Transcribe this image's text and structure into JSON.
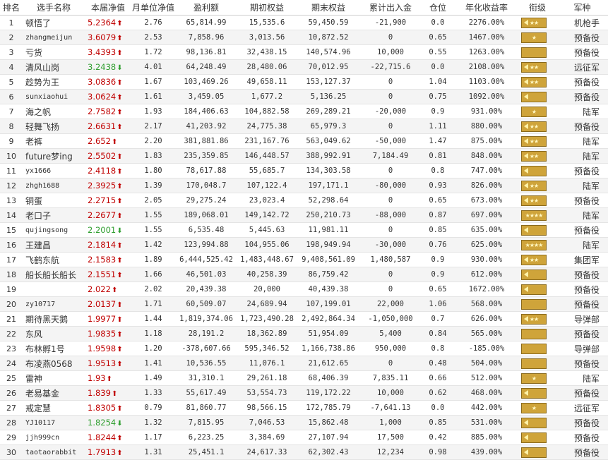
{
  "headers": [
    "排名",
    "选手名称",
    "本届净值",
    "月单位净值",
    "盈利额",
    "期初权益",
    "期末权益",
    "累计出入金",
    "仓位",
    "年化收益率",
    "衔级",
    "军种"
  ],
  "colors": {
    "up": "#c00000",
    "down": "#2f9e2f",
    "badge": "#cfa43a"
  },
  "rows": [
    {
      "rank": "1",
      "name": "顿悟了",
      "net": "5.2364",
      "dir": "up",
      "monthly": "2.76",
      "profit": "65,814.99",
      "start": "15,535.6",
      "end": "59,450.59",
      "flow": "-21,900",
      "pos": "0.0",
      "annual": "2276.00%",
      "badge": "chevron-stars",
      "army": "机枪手"
    },
    {
      "rank": "2",
      "name": "zhangmeijun",
      "net": "3.6079",
      "dir": "up",
      "monthly": "2.53",
      "profit": "7,858.96",
      "start": "3,013.56",
      "end": "10,872.52",
      "flow": "0",
      "pos": "0.65",
      "annual": "1467.00%",
      "badge": "star",
      "army": "预备役"
    },
    {
      "rank": "3",
      "name": "亏货",
      "net": "3.4393",
      "dir": "up",
      "monthly": "1.72",
      "profit": "98,136.81",
      "start": "32,438.15",
      "end": "140,574.96",
      "flow": "10,000",
      "pos": "0.55",
      "annual": "1263.00%",
      "badge": "bar",
      "army": "预备役"
    },
    {
      "rank": "4",
      "name": "清风山岗",
      "net": "3.2438",
      "dir": "down",
      "monthly": "4.01",
      "profit": "64,248.49",
      "start": "28,480.06",
      "end": "70,012.95",
      "flow": "-22,715.6",
      "pos": "0.0",
      "annual": "2108.00%",
      "badge": "chevron-stars",
      "army": "远征军"
    },
    {
      "rank": "5",
      "name": "趁势为王",
      "net": "3.0836",
      "dir": "up",
      "monthly": "1.67",
      "profit": "103,469.26",
      "start": "49,658.11",
      "end": "153,127.37",
      "flow": "0",
      "pos": "1.04",
      "annual": "1103.00%",
      "badge": "chevron-stars",
      "army": "预备役"
    },
    {
      "rank": "6",
      "name": "sunxiaohui",
      "net": "3.0624",
      "dir": "up",
      "monthly": "1.61",
      "profit": "3,459.05",
      "start": "1,677.2",
      "end": "5,136.25",
      "flow": "0",
      "pos": "0.75",
      "annual": "1092.00%",
      "badge": "chevron",
      "army": "预备役"
    },
    {
      "rank": "7",
      "name": "海之帆",
      "net": "2.7582",
      "dir": "up",
      "monthly": "1.93",
      "profit": "184,406.63",
      "start": "104,882.58",
      "end": "269,289.21",
      "flow": "-20,000",
      "pos": "0.9",
      "annual": "931.00%",
      "badge": "star",
      "army": "陆军"
    },
    {
      "rank": "8",
      "name": "轻舞飞扬",
      "net": "2.6631",
      "dir": "up",
      "monthly": "2.17",
      "profit": "41,203.92",
      "start": "24,775.38",
      "end": "65,979.3",
      "flow": "0",
      "pos": "1.11",
      "annual": "880.00%",
      "badge": "chevron-stars",
      "army": "预备役"
    },
    {
      "rank": "9",
      "name": "老裤",
      "net": "2.652",
      "dir": "up",
      "monthly": "2.20",
      "profit": "381,881.86",
      "start": "231,167.76",
      "end": "563,049.62",
      "flow": "-50,000",
      "pos": "1.47",
      "annual": "875.00%",
      "badge": "chevron-stars",
      "army": "陆军"
    },
    {
      "rank": "10",
      "name": "future梦ing",
      "net": "2.5502",
      "dir": "up",
      "monthly": "1.83",
      "profit": "235,359.85",
      "start": "146,448.57",
      "end": "388,992.91",
      "flow": "7,184.49",
      "pos": "0.81",
      "annual": "848.00%",
      "badge": "chevron-stars",
      "army": "陆军"
    },
    {
      "rank": "11",
      "name": "yx1666",
      "net": "2.4118",
      "dir": "up",
      "monthly": "1.80",
      "profit": "78,617.88",
      "start": "55,685.7",
      "end": "134,303.58",
      "flow": "0",
      "pos": "0.8",
      "annual": "747.00%",
      "badge": "chevron",
      "army": "预备役"
    },
    {
      "rank": "12",
      "name": "zhgh1688",
      "net": "2.3925",
      "dir": "up",
      "monthly": "1.39",
      "profit": "170,048.7",
      "start": "107,122.4",
      "end": "197,171.1",
      "flow": "-80,000",
      "pos": "0.93",
      "annual": "826.00%",
      "badge": "chevron-stars",
      "army": "陆军"
    },
    {
      "rank": "13",
      "name": "铜蛋",
      "net": "2.2715",
      "dir": "up",
      "monthly": "2.05",
      "profit": "29,275.24",
      "start": "23,023.4",
      "end": "52,298.64",
      "flow": "0",
      "pos": "0.65",
      "annual": "673.00%",
      "badge": "chevron-stars",
      "army": "预备役"
    },
    {
      "rank": "14",
      "name": "老口子",
      "net": "2.2677",
      "dir": "up",
      "monthly": "1.55",
      "profit": "189,068.01",
      "start": "149,142.72",
      "end": "250,210.73",
      "flow": "-88,000",
      "pos": "0.87",
      "annual": "697.00%",
      "badge": "stars4",
      "army": "陆军"
    },
    {
      "rank": "15",
      "name": "qujingsong",
      "net": "2.2001",
      "dir": "down",
      "monthly": "1.55",
      "profit": "6,535.48",
      "start": "5,445.63",
      "end": "11,981.11",
      "flow": "0",
      "pos": "0.85",
      "annual": "635.00%",
      "badge": "chevron",
      "army": "预备役"
    },
    {
      "rank": "16",
      "name": "王建昌",
      "net": "2.1814",
      "dir": "up",
      "monthly": "1.42",
      "profit": "123,994.88",
      "start": "104,955.06",
      "end": "198,949.94",
      "flow": "-30,000",
      "pos": "0.76",
      "annual": "625.00%",
      "badge": "stars4",
      "army": "陆军"
    },
    {
      "rank": "17",
      "name": "飞鹤东航",
      "net": "2.1583",
      "dir": "up",
      "monthly": "1.89",
      "profit": "6,444,525.42",
      "start": "1,483,448.67",
      "end": "9,408,561.09",
      "flow": "1,480,587",
      "pos": "0.9",
      "annual": "930.00%",
      "badge": "chevron-stars",
      "army": "集团军"
    },
    {
      "rank": "18",
      "name": "船长船长船长",
      "net": "2.1551",
      "dir": "up",
      "monthly": "1.66",
      "profit": "46,501.03",
      "start": "40,258.39",
      "end": "86,759.42",
      "flow": "0",
      "pos": "0.9",
      "annual": "612.00%",
      "badge": "chevron",
      "army": "预备役"
    },
    {
      "rank": "19",
      "name": "",
      "net": "2.022",
      "dir": "up",
      "monthly": "2.02",
      "profit": "20,439.38",
      "start": "20,000",
      "end": "40,439.38",
      "flow": "0",
      "pos": "0.65",
      "annual": "1672.00%",
      "badge": "chevron",
      "army": "预备役"
    },
    {
      "rank": "20",
      "name": "zy10717",
      "net": "2.0137",
      "dir": "up",
      "monthly": "1.71",
      "profit": "60,509.07",
      "start": "24,689.94",
      "end": "107,199.01",
      "flow": "22,000",
      "pos": "1.06",
      "annual": "568.00%",
      "badge": "bar",
      "army": "预备役"
    },
    {
      "rank": "21",
      "name": "期待黑天鹅",
      "net": "1.9977",
      "dir": "up",
      "monthly": "1.44",
      "profit": "1,819,374.06",
      "start": "1,723,490.28",
      "end": "2,492,864.34",
      "flow": "-1,050,000",
      "pos": "0.7",
      "annual": "626.00%",
      "badge": "chevron-stars",
      "army": "导弹部"
    },
    {
      "rank": "22",
      "name": "东风",
      "net": "1.9835",
      "dir": "up",
      "monthly": "1.18",
      "profit": "28,191.2",
      "start": "18,362.89",
      "end": "51,954.09",
      "flow": "5,400",
      "pos": "0.84",
      "annual": "565.00%",
      "badge": "bar",
      "army": "预备役"
    },
    {
      "rank": "23",
      "name": "布林孵1号",
      "net": "1.9598",
      "dir": "up",
      "monthly": "1.20",
      "profit": "-378,607.66",
      "start": "595,346.52",
      "end": "1,166,738.86",
      "flow": "950,000",
      "pos": "0.8",
      "annual": "-185.00%",
      "badge": "bar",
      "army": "导弹部"
    },
    {
      "rank": "24",
      "name": "布凌燕0568",
      "net": "1.9513",
      "dir": "up",
      "monthly": "1.41",
      "profit": "10,536.55",
      "start": "11,076.1",
      "end": "21,612.65",
      "flow": "0",
      "pos": "0.48",
      "annual": "504.00%",
      "badge": "bar",
      "army": "预备役"
    },
    {
      "rank": "25",
      "name": "雷神",
      "net": "1.93",
      "dir": "up",
      "monthly": "1.49",
      "profit": "31,310.1",
      "start": "29,261.18",
      "end": "68,406.39",
      "flow": "7,835.11",
      "pos": "0.66",
      "annual": "512.00%",
      "badge": "star",
      "army": "陆军"
    },
    {
      "rank": "26",
      "name": "老易基金",
      "net": "1.839",
      "dir": "up",
      "monthly": "1.33",
      "profit": "55,617.49",
      "start": "53,554.73",
      "end": "119,172.22",
      "flow": "10,000",
      "pos": "0.62",
      "annual": "468.00%",
      "badge": "chevron",
      "army": "预备役"
    },
    {
      "rank": "27",
      "name": "戒定慧",
      "net": "1.8305",
      "dir": "up",
      "monthly": "0.79",
      "profit": "81,860.77",
      "start": "98,566.15",
      "end": "172,785.79",
      "flow": "-7,641.13",
      "pos": "0.0",
      "annual": "442.00%",
      "badge": "star",
      "army": "远征军"
    },
    {
      "rank": "28",
      "name": "YJ10117",
      "net": "1.8254",
      "dir": "down",
      "monthly": "1.32",
      "profit": "7,815.95",
      "start": "7,046.53",
      "end": "15,862.48",
      "flow": "1,000",
      "pos": "0.85",
      "annual": "531.00%",
      "badge": "chevron",
      "army": "预备役"
    },
    {
      "rank": "29",
      "name": "jjh999cn",
      "net": "1.8244",
      "dir": "up",
      "monthly": "1.17",
      "profit": "6,223.25",
      "start": "3,384.69",
      "end": "27,107.94",
      "flow": "17,500",
      "pos": "0.42",
      "annual": "885.00%",
      "badge": "chevron",
      "army": "预备役"
    },
    {
      "rank": "30",
      "name": "taotaorabbit",
      "net": "1.7913",
      "dir": "up",
      "monthly": "1.31",
      "profit": "25,451.1",
      "start": "24,617.33",
      "end": "62,302.43",
      "flow": "12,234",
      "pos": "0.98",
      "annual": "439.00%",
      "badge": "chevron",
      "army": "预备役"
    }
  ]
}
